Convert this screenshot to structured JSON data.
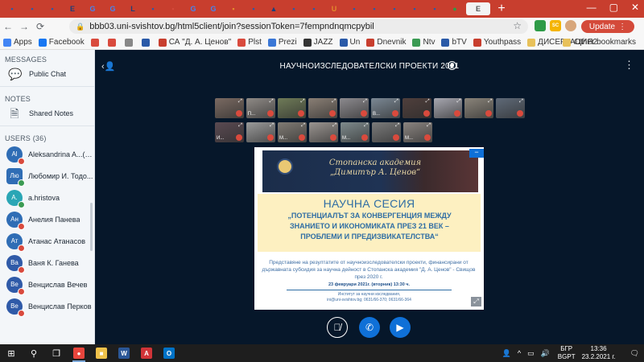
{
  "browser": {
    "tabs": [
      {
        "glyph": "▪",
        "color": "#2a5aa8"
      },
      {
        "glyph": "▪",
        "color": "#2a5aa8"
      },
      {
        "glyph": "▪",
        "color": "#2a5aa8"
      },
      {
        "glyph": "E",
        "color": "#1b3f7a"
      },
      {
        "glyph": "G",
        "color": "#4285f4"
      },
      {
        "glyph": "G",
        "color": "#4285f4"
      },
      {
        "glyph": "L",
        "color": "#1b3f7a"
      },
      {
        "glyph": "▪",
        "color": "#2a5aa8"
      },
      {
        "glyph": "▪",
        "color": "#d44a3a"
      },
      {
        "glyph": "G",
        "color": "#4285f4"
      },
      {
        "glyph": "G",
        "color": "#4285f4"
      },
      {
        "glyph": "▪",
        "color": "#e38b2c"
      },
      {
        "glyph": "▪",
        "color": "#2a5aa8"
      },
      {
        "glyph": "▲",
        "color": "#1b3f7a"
      },
      {
        "glyph": "▪",
        "color": "#2a5aa8"
      },
      {
        "glyph": "▪",
        "color": "#2a5aa8"
      },
      {
        "glyph": "U",
        "color": "#e38b2c"
      },
      {
        "glyph": "▪",
        "color": "#2a5aa8"
      },
      {
        "glyph": "▪",
        "color": "#2a5aa8"
      },
      {
        "glyph": "▪",
        "color": "#2a5aa8"
      },
      {
        "glyph": "▪",
        "color": "#2a5aa8"
      },
      {
        "glyph": "▪",
        "color": "#2a5aa8"
      },
      {
        "glyph": "●",
        "color": "#2e9b47"
      }
    ],
    "active_tab_glyph": "E",
    "url": "bbb03.uni-svishtov.bg/html5client/join?sessionToken=7fempndnqmcpybil",
    "ext_sc": "SC",
    "update_label": "Update",
    "bookmarks": [
      {
        "label": "Apps",
        "color": "#4285f4"
      },
      {
        "label": "Facebook",
        "color": "#1877f2"
      },
      {
        "label": "",
        "color": "#d94a3d"
      },
      {
        "label": "",
        "color": "#d94a3d"
      },
      {
        "label": "",
        "color": "#888888"
      },
      {
        "label": "",
        "color": "#2a5aa8"
      },
      {
        "label": "СА \"Д. А. Ценов\"",
        "color": "#c83e2e"
      },
      {
        "label": "Plst",
        "color": "#d94a3d"
      },
      {
        "label": "Prezi",
        "color": "#3a77d6"
      },
      {
        "label": "JAZZ",
        "color": "#333333"
      },
      {
        "label": "Un",
        "color": "#2a5aa8"
      },
      {
        "label": "Dnevnik",
        "color": "#c83e2e"
      },
      {
        "label": "Ntv",
        "color": "#3b9b53"
      },
      {
        "label": "bTV",
        "color": "#2a5aa8"
      },
      {
        "label": "Youthpass",
        "color": "#c83e2e"
      },
      {
        "label": "ДИСЕРТАЦИЯ2",
        "color": "#e8c15a"
      }
    ],
    "other_bookmarks": "Other bookmarks"
  },
  "sidebar": {
    "messages_title": "MESSAGES",
    "public_chat": "Public Chat",
    "notes_title": "NOTES",
    "shared_notes": "Shared Notes",
    "users_title": "USERS (36)",
    "users": [
      {
        "initials": "Al",
        "name": "Aleksandrina A...(You)",
        "color": "#2f6db5",
        "square": false,
        "badge": "red"
      },
      {
        "initials": "Лю",
        "name": "Любомир И. Тодо...",
        "color": "#2f6db5",
        "square": true,
        "badge": "green"
      },
      {
        "initials": "A.",
        "name": "a.hristova",
        "color": "#2aa6b5",
        "square": false,
        "badge": "green"
      },
      {
        "initials": "Ан",
        "name": "Анелия Панева",
        "color": "#2f6db5",
        "square": false,
        "badge": "red"
      },
      {
        "initials": "Ат",
        "name": "Атанас Атанасов",
        "color": "#2f6db5",
        "square": false,
        "badge": "red"
      },
      {
        "initials": "Ва",
        "name": "Ваня К. Ганева",
        "color": "#2f5aa8",
        "square": false,
        "badge": "red"
      },
      {
        "initials": "Ве",
        "name": "Венцислав Вечев",
        "color": "#2f5aa8",
        "square": false,
        "badge": "red"
      },
      {
        "initials": "Ве",
        "name": "Венцислав Перков",
        "color": "#2f5aa8",
        "square": false,
        "badge": "red"
      }
    ]
  },
  "meeting": {
    "title": "НАУЧНОИЗСЛЕДОВАТЕЛСКИ ПРОЕКТИ",
    "year": "2021",
    "webcams_row1": [
      {
        "name": "",
        "bg": "#7a6a62"
      },
      {
        "name": "П...",
        "bg": "#8f8a86"
      },
      {
        "name": "",
        "bg": "#6f7b58"
      },
      {
        "name": "",
        "bg": "#8a7f75"
      },
      {
        "name": "",
        "bg": "#8c8a8e"
      },
      {
        "name": "В...",
        "bg": "#7b8894"
      },
      {
        "name": "",
        "bg": "#4f3f3c"
      },
      {
        "name": "",
        "bg": "#a7a7b0"
      },
      {
        "name": "",
        "bg": "#8a847a"
      },
      {
        "name": "",
        "bg": "#5f6a78"
      }
    ],
    "webcams_row2": [
      {
        "name": "И...",
        "bg": "#5a4a52"
      },
      {
        "name": "",
        "bg": "#9a9a9a"
      },
      {
        "name": "М...",
        "bg": "#807b74"
      },
      {
        "name": "",
        "bg": "#9a9490"
      },
      {
        "name": "М...",
        "bg": "#7e8a8c"
      },
      {
        "name": "",
        "bg": "#7b7b7b"
      },
      {
        "name": "М...",
        "bg": "#8a8480"
      }
    ],
    "slide": {
      "institution": "Стопанска академия\n„Димитър А. Ценов“",
      "heading": "НАУЧНА СЕСИЯ",
      "subheading": "„ПОТЕНЦИАЛЪТ ЗА КОНВЕРГЕНЦИЯ МЕЖДУ ЗНАНИЕТО И ИКОНОМИКАТА ПРЕЗ 21 ВЕК – ПРОБЛЕМИ И ПРЕДИЗВИКАТЕЛСТВА“",
      "body": "Представяне на резултатите от научноизследователски проекти, финансирани от държавната субсидия за научна дейност в Стопанска академия \"Д. А. Ценов\" - Свищов през 2020 г.",
      "date": "23 февруари 2021г. (вторник) 13:30 ч.",
      "footer": "Институт за научни изследвания,\nini@uni-svishtov.bg; 0631/66-370; 0631/66-364"
    }
  },
  "taskbar": {
    "lang_top": "БГР",
    "lang_bottom": "BGPT",
    "time": "13:36",
    "date": "23.2.2021 г.",
    "apps": [
      {
        "glyph": "●",
        "color": "#e8453c"
      },
      {
        "glyph": "■",
        "color": "#f0c24b"
      },
      {
        "glyph": "W",
        "color": "#2b5797"
      },
      {
        "glyph": "A",
        "color": "#d13438"
      },
      {
        "glyph": "O",
        "color": "#0072c6"
      }
    ]
  }
}
